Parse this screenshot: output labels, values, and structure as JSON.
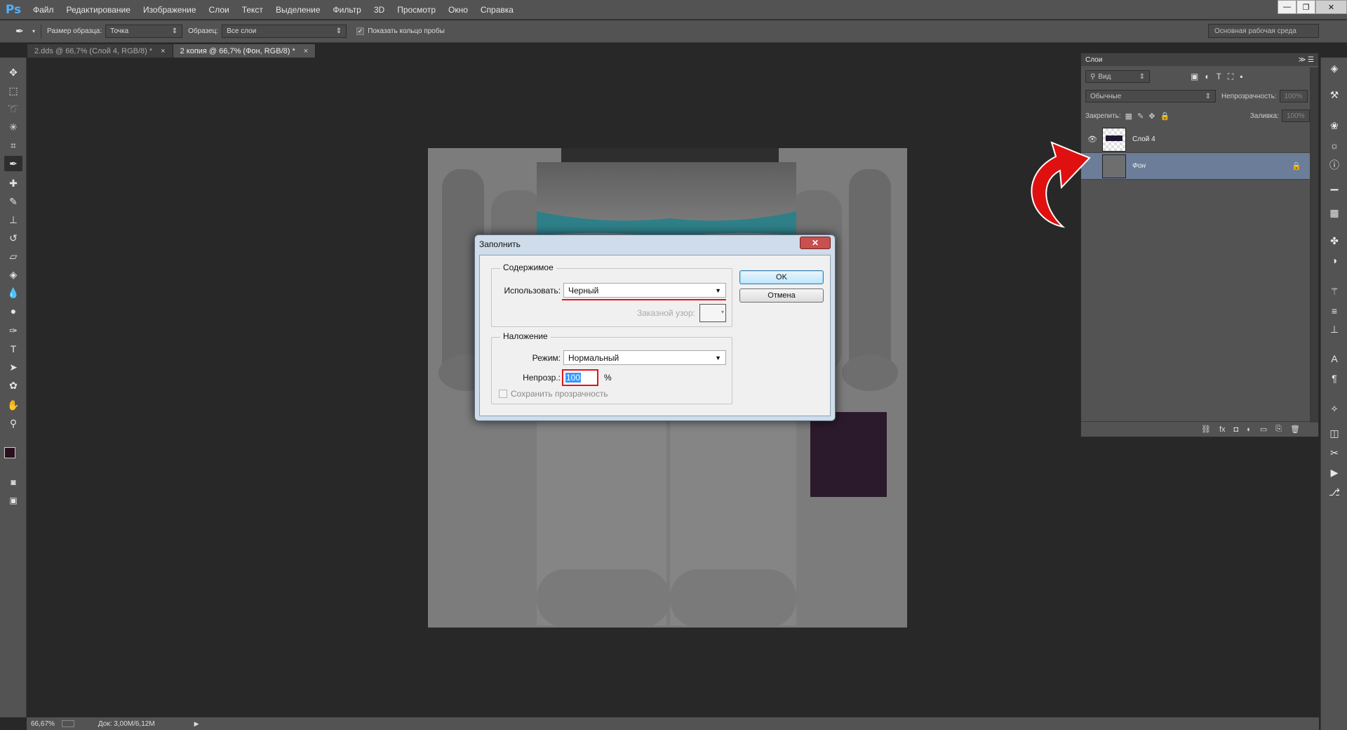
{
  "app": {
    "logo": "Ps"
  },
  "menu": [
    "Файл",
    "Редактирование",
    "Изображение",
    "Слои",
    "Текст",
    "Выделение",
    "Фильтр",
    "3D",
    "Просмотр",
    "Окно",
    "Справка"
  ],
  "window_controls": {
    "minimize": "—",
    "restore": "❐",
    "close": "✕"
  },
  "options_bar": {
    "sample_size_label": "Размер образца:",
    "sample_size_value": "Точка",
    "sample_label": "Образец:",
    "sample_value": "Все слои",
    "show_ring_label": "Показать кольцо пробы",
    "show_ring_checked": true
  },
  "workspace": "Основная рабочая среда",
  "tabs": [
    {
      "label": "2.dds @ 66,7% (Слой 4, RGB/8) *",
      "close": "×",
      "active": false
    },
    {
      "label": "2 копия @ 66,7% (Фон, RGB/8) *",
      "close": "×",
      "active": true
    }
  ],
  "status": {
    "zoom": "66,67%",
    "doc": "Док: 3,00M/6,12M"
  },
  "layers_panel": {
    "title": "Слои",
    "filter_label": "Вид",
    "blend_mode": "Обычные",
    "opacity_label": "Непрозрачность:",
    "opacity_value": "100%",
    "lock_label": "Закрепить:",
    "fill_label": "Заливка:",
    "fill_value": "100%",
    "layers": [
      {
        "name": "Слой 4",
        "visible": true,
        "selected": false
      },
      {
        "name": "Фон",
        "visible": false,
        "selected": true,
        "locked": true
      }
    ]
  },
  "fill_dialog": {
    "title": "Заполнить",
    "close": "✕",
    "contents_group": "Содержимое",
    "use_label": "Использовать:",
    "use_value": "Черный",
    "pattern_label": "Заказной узор:",
    "blending_group": "Наложение",
    "mode_label": "Режим:",
    "mode_value": "Нормальный",
    "opacity_label": "Непрозр.:",
    "opacity_value": "100",
    "opacity_unit": "%",
    "preserve_label": "Сохранить прозрачность",
    "ok": "OK",
    "cancel": "Отмена"
  },
  "colors": {
    "accent_red": "#e0141a",
    "selected_layer": "#6b7d99"
  }
}
